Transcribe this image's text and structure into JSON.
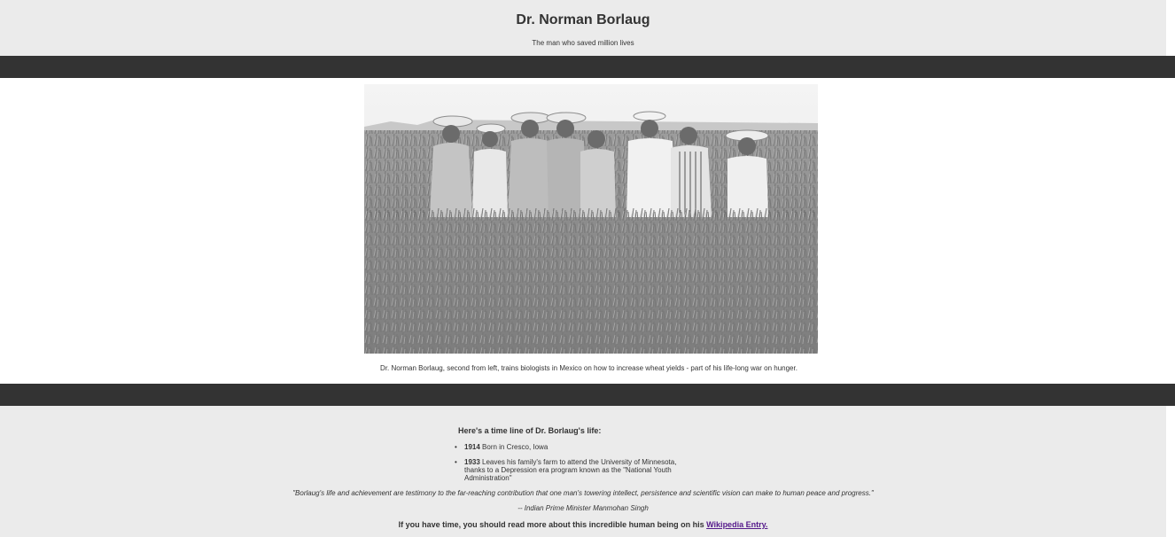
{
  "header": {
    "title": "Dr. Norman Borlaug",
    "subtitle": "The man who saved million lives"
  },
  "photo": {
    "caption": "Dr. Norman Borlaug, second from left, trains biologists in Mexico on how to increase wheat yields - part of his life-long war on hunger."
  },
  "timeline": {
    "heading": "Here's a time line of Dr. Borlaug's life:",
    "items": [
      {
        "year": "1914",
        "text": "Born in Cresco, Iowa"
      },
      {
        "year": "1933",
        "text": "Leaves his family's farm to attend the University of Minnesota, thanks to a Depression era program known as the \"National Youth Administration\""
      }
    ]
  },
  "quote": {
    "text": "\"Borlaug's life and achievement are testimony to the far-reaching contribution that one man's towering intellect, persistence and scientific vision can make to human peace and progress.\"",
    "attribution": "-- Indian Prime Minister Manmohan Singh"
  },
  "more": {
    "text": "If you have time, you should read more about this incredible human being on his",
    "link_label": "Wikipedia Entry."
  },
  "colors": {
    "page_bg": "#ebebeb",
    "band": "#333333",
    "link": "#551a8b"
  }
}
